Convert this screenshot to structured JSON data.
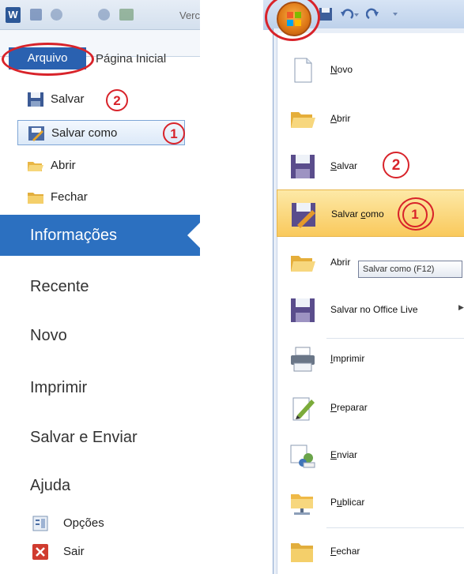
{
  "left": {
    "qat": {
      "app_letter": "W",
      "version_text": "Verc"
    },
    "tabs": {
      "arquivo": "Arquivo",
      "pagina_inicial": "Página Inicial"
    },
    "quick_items": [
      {
        "label": "Salvar",
        "icon": "save-icon",
        "marker": "2"
      },
      {
        "label": "Salvar como",
        "icon": "save-as-icon",
        "marker": "1"
      },
      {
        "label": "Abrir",
        "icon": "open-folder-icon"
      },
      {
        "label": "Fechar",
        "icon": "close-folder-icon"
      }
    ],
    "big_items": [
      "Informações",
      "Recente",
      "Novo",
      "Imprimir",
      "Salvar e Enviar",
      "Ajuda"
    ],
    "small_items": [
      {
        "label": "Opções",
        "icon": "options-icon"
      },
      {
        "label": "Sair",
        "icon": "exit-icon"
      }
    ]
  },
  "right": {
    "items": [
      {
        "pre": "",
        "acc": "N",
        "post": "ovo",
        "icon": "new-document-icon",
        "arrow": false
      },
      {
        "pre": "",
        "acc": "A",
        "post": "brir",
        "icon": "open-folder-icon",
        "arrow": false
      },
      {
        "pre": "",
        "acc": "S",
        "post": "alvar",
        "icon": "save-icon",
        "arrow": false,
        "marker": "2"
      },
      {
        "pre": "Salvar ",
        "acc": "c",
        "post": "omo",
        "icon": "save-as-icon",
        "arrow": true,
        "marker": "1",
        "highlight": true
      },
      {
        "pre": "Abrir",
        "acc": "",
        "post": "",
        "icon": "open-folder-icon",
        "arrow": false
      },
      {
        "pre": "Salvar no Office Live",
        "acc": "",
        "post": "",
        "icon": "save-icon",
        "arrow": true
      },
      {
        "pre": "",
        "acc": "I",
        "post": "mprimir",
        "icon": "printer-icon",
        "arrow": true
      },
      {
        "pre": "",
        "acc": "P",
        "post": "reparar",
        "icon": "prepare-icon",
        "arrow": true
      },
      {
        "pre": "",
        "acc": "E",
        "post": "nviar",
        "icon": "send-icon",
        "arrow": true
      },
      {
        "pre": "P",
        "acc": "u",
        "post": "blicar",
        "icon": "publish-icon",
        "arrow": true
      },
      {
        "pre": "",
        "acc": "F",
        "post": "echar",
        "icon": "close-folder-icon",
        "arrow": false
      }
    ],
    "tooltip": "Salvar como (F12)"
  },
  "colors": {
    "accent_blue": "#2c70c0",
    "annotation_red": "#d8232a",
    "highlight_gold": "#f9c95c"
  }
}
